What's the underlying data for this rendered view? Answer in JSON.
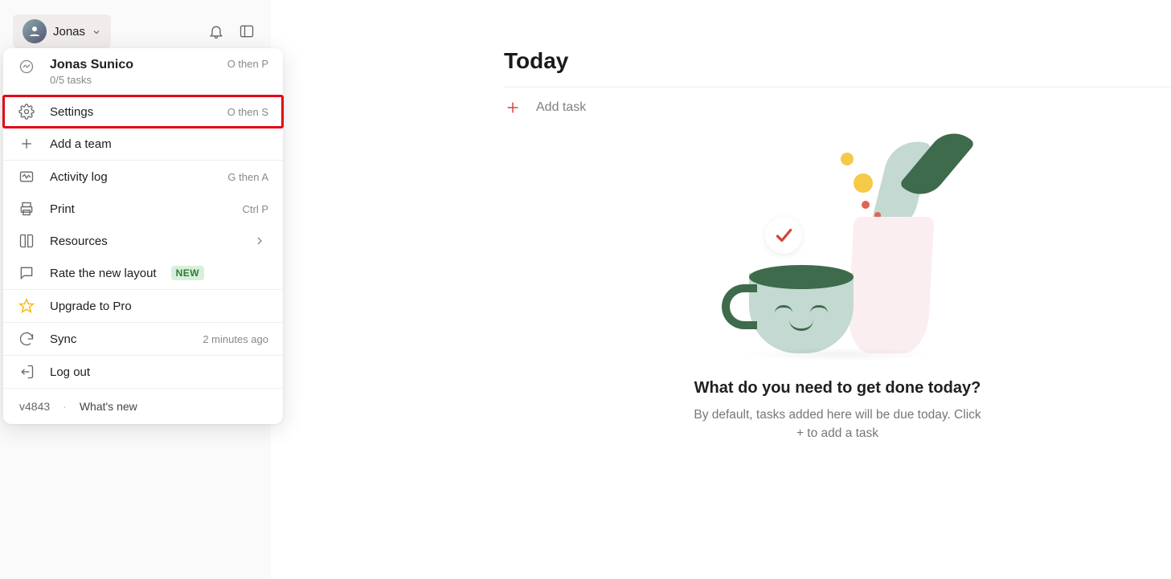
{
  "sidebar": {
    "user_shortname": "Jonas"
  },
  "menu": {
    "profile": {
      "name": "Jonas Sunico",
      "tasks": "0/5 tasks",
      "shortcut": "O then P"
    },
    "settings": {
      "label": "Settings",
      "shortcut": "O then S"
    },
    "add_team": {
      "label": "Add a team"
    },
    "activity": {
      "label": "Activity log",
      "shortcut": "G then A"
    },
    "print": {
      "label": "Print",
      "shortcut": "Ctrl P"
    },
    "resources": {
      "label": "Resources"
    },
    "rate": {
      "label": "Rate the new layout",
      "badge": "NEW"
    },
    "upgrade": {
      "label": "Upgrade to Pro"
    },
    "sync": {
      "label": "Sync",
      "hint": "2 minutes ago"
    },
    "logout": {
      "label": "Log out"
    },
    "version": "v4843",
    "whats_new": "What's new"
  },
  "main": {
    "title": "Today",
    "add_task": "Add task",
    "empty_title": "What do you need to get done today?",
    "empty_subtitle": "By default, tasks added here will be due today. Click + to add a task"
  }
}
